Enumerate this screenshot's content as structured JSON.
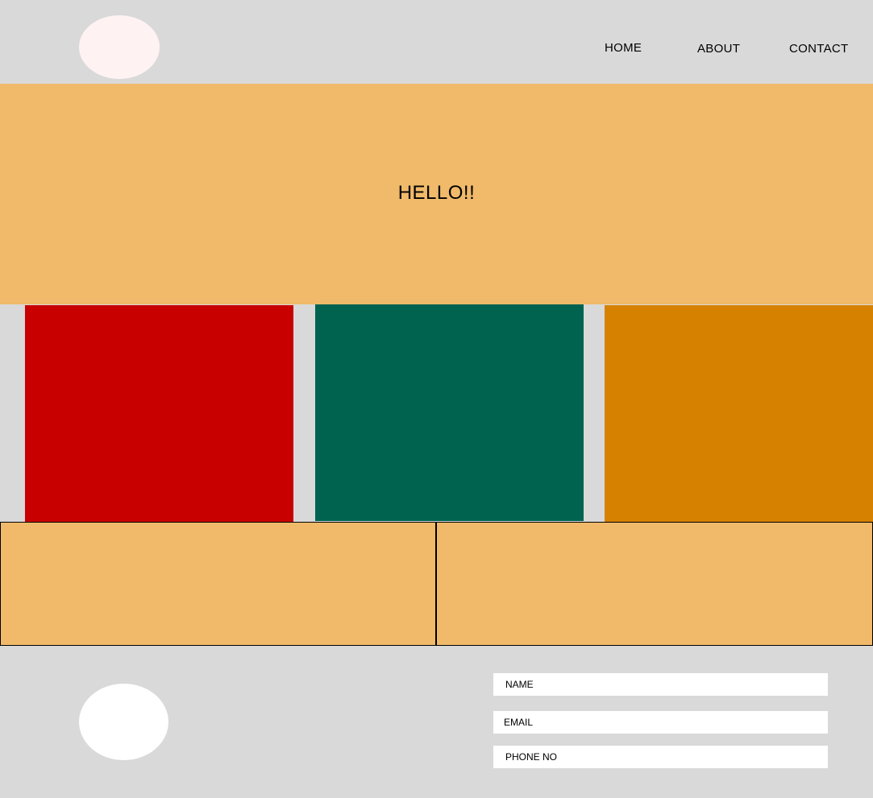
{
  "header": {
    "nav": {
      "home": "HOME",
      "about": "ABOUT",
      "contact": "CONTACT"
    }
  },
  "hero": {
    "title": "HELLO!!"
  },
  "colors": {
    "background": "#d9d9d9",
    "hero": "#f0ba6a",
    "card_red": "#c90000",
    "card_green": "#006350",
    "card_orange": "#d68100",
    "logo": "#fff2f2"
  },
  "footer": {
    "form": {
      "name_placeholder": "NAME",
      "email_placeholder": "EMAIL",
      "phone_placeholder": "PHONE NO"
    }
  }
}
